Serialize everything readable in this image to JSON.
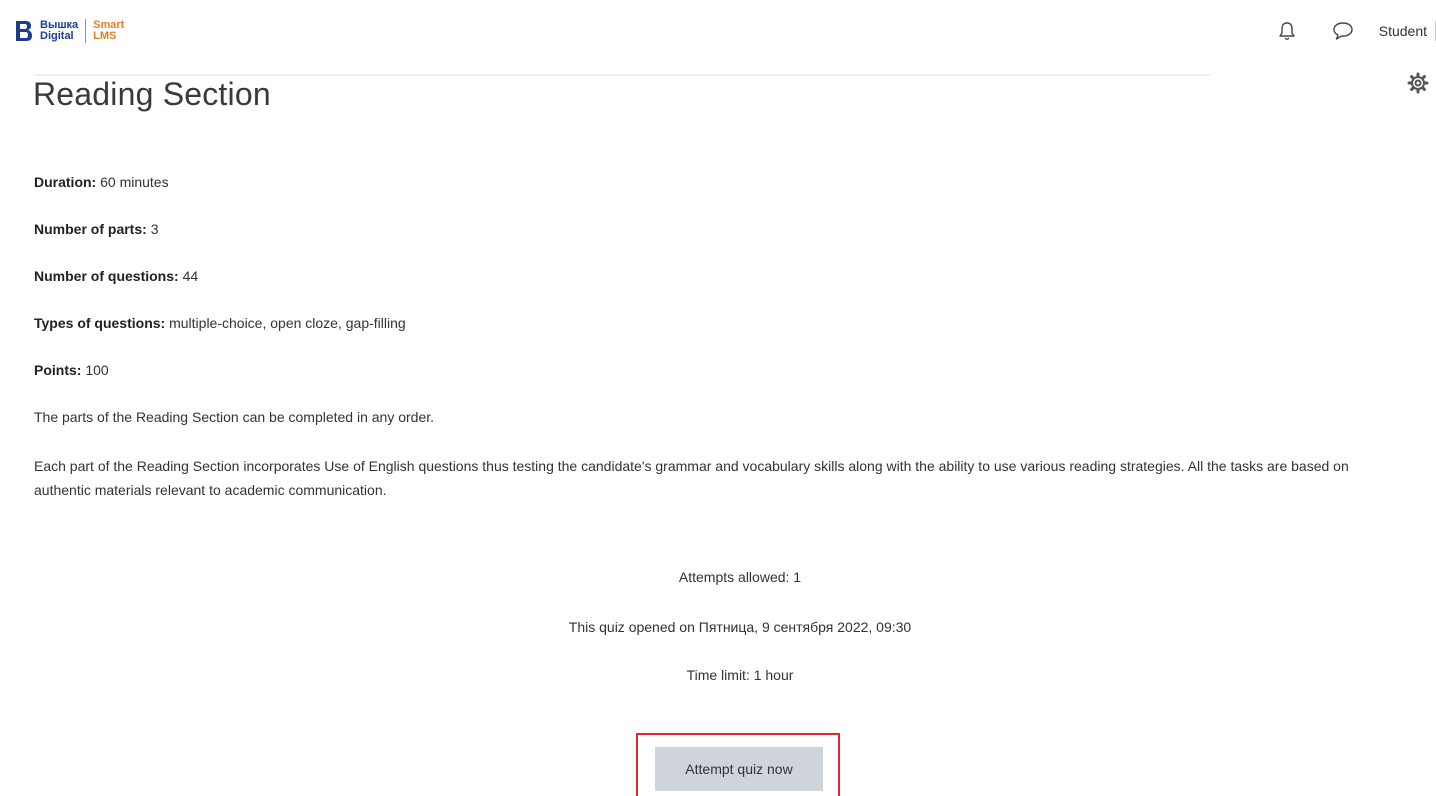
{
  "header": {
    "logo_line1": "Вышка",
    "logo_line2": "Digital",
    "logo_sub1": "Smart",
    "logo_sub2": "LMS",
    "user_name": "Student",
    "icons": [
      "bell-icon",
      "chat-icon",
      "gear-icon"
    ]
  },
  "page": {
    "title": "Reading Section"
  },
  "details": {
    "duration_label": "Duration:",
    "duration_value": "60 minutes",
    "parts_label": "Number of parts:",
    "parts_value": "3",
    "questions_label": "Number of questions:",
    "questions_value": "44",
    "types_label": "Types of questions:",
    "types_value": "multiple-choice, open cloze, gap-filling",
    "points_label": "Points:",
    "points_value": "100",
    "order_note": "The parts of the Reading Section can be completed in any order.",
    "description": "Each part of the Reading Section incorporates Use of English questions thus testing the candidate's grammar and vocabulary skills along with the ability to use various reading strategies. All the tasks are based on authentic materials relevant to academic communication."
  },
  "quiz_info": {
    "attempts": "Attempts allowed: 1",
    "opened": "This quiz opened on Пятница, 9 сентября 2022, 09:30",
    "time_limit": "Time limit: 1 hour"
  },
  "actions": {
    "attempt_label": "Attempt quiz now"
  },
  "colors": {
    "brand_blue": "#1a3e8c",
    "brand_orange": "#e67e22",
    "highlight_red": "#e02b2b",
    "button_bg": "#ced4da"
  }
}
